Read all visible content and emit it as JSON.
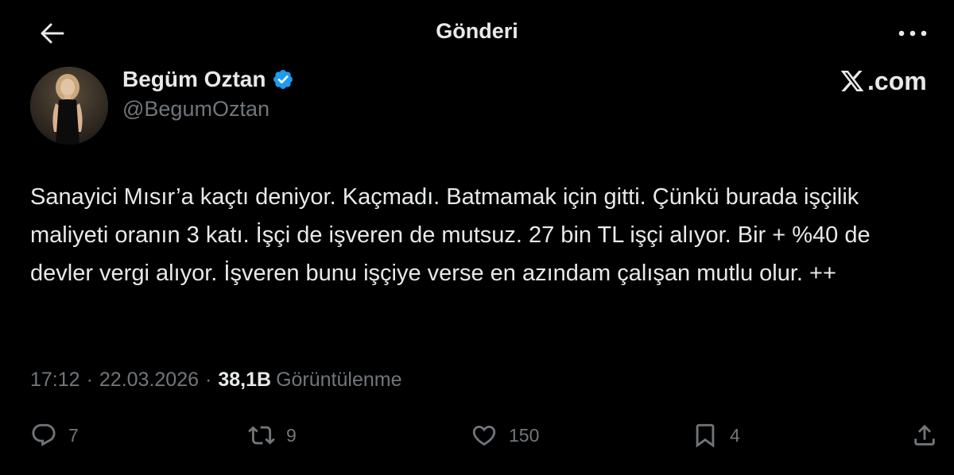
{
  "header": {
    "title": "Gönderi",
    "back_icon": "arrow-left-icon",
    "more_icon": "more-horizontal-icon"
  },
  "author": {
    "name": "Begüm Oztan",
    "handle": "@BegumOztan",
    "verified": true,
    "verified_color": "#1d9bf0"
  },
  "brand": {
    "suffix": ".com",
    "icon": "x-logo-icon"
  },
  "tweet": {
    "text": "Sanayici Mısır’a kaçtı deniyor. Kaçmadı. Batmamak için gitti. Çünkü burada işçilik maliyeti oranın 3 katı. İşçi de işveren de mutsuz. 27 bin TL işçi alıyor. Bir + %40 de devler vergi alıyor. İşveren bunu işçiye verse en azındam çalışan mutlu olur. ++"
  },
  "meta": {
    "time": "17:12",
    "separator": "·",
    "date": "22.03.2026",
    "views_count": "38,1B",
    "views_label": "Görüntülenme"
  },
  "actions": {
    "reply_count": "7",
    "retweet_count": "9",
    "like_count": "150",
    "bookmark_count": "4"
  },
  "colors": {
    "background": "#000000",
    "text_primary": "#e7e9ea",
    "text_secondary": "#71767b"
  }
}
